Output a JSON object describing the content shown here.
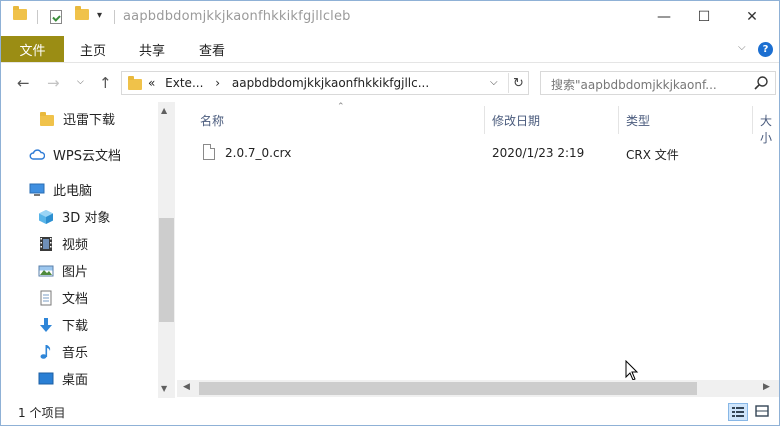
{
  "window": {
    "title": "aapbdbdomjkkjkaonfhkkikfgjllcleb",
    "controls": {
      "minimize": "—",
      "maximize": "☐",
      "close": "✕"
    }
  },
  "ribbon": {
    "file_tab": "文件",
    "tabs": [
      "主页",
      "共享",
      "查看"
    ],
    "help": "?"
  },
  "address": {
    "path_prefix": "«",
    "crumb_parent": "Exte...",
    "crumb_sep": "›",
    "crumb_current": "aapbdbdomjkkjkaonfhkkikfgjllc...",
    "search_placeholder": "搜索\"aapbdbdomjkkjkaonf..."
  },
  "sidebar": {
    "items": [
      {
        "label": "迅雷下载",
        "icon": "folder-icon"
      },
      {
        "label": "WPS云文档",
        "icon": "cloud-icon"
      },
      {
        "label": "此电脑",
        "icon": "computer-icon"
      },
      {
        "label": "3D 对象",
        "icon": "cube-3d-icon"
      },
      {
        "label": "视频",
        "icon": "video-icon"
      },
      {
        "label": "图片",
        "icon": "picture-icon"
      },
      {
        "label": "文档",
        "icon": "document-icon"
      },
      {
        "label": "下载",
        "icon": "download-arrow-icon"
      },
      {
        "label": "音乐",
        "icon": "music-note-icon"
      },
      {
        "label": "桌面",
        "icon": "desktop-icon"
      }
    ]
  },
  "columns": {
    "name": "名称",
    "modified": "修改日期",
    "type": "类型",
    "size": "大小"
  },
  "files": [
    {
      "name": "2.0.7_0.crx",
      "modified": "2020/1/23 2:19",
      "type": "CRX 文件"
    }
  ],
  "status": {
    "item_count": "1 个项目"
  },
  "colors": {
    "file_tab_bg": "#9b8d14",
    "accent_blue": "#1c6fd1",
    "folder_yellow": "#f0c24a"
  }
}
